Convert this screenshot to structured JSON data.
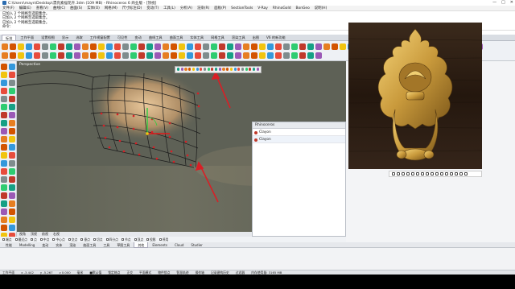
{
  "titlebar": {
    "title": "C:\\Users\\mayn\\Desktop\\漂亮素描花卉.3dm (109 MB) - Rhinoceros 6 商业版 - [顶视]",
    "controls": [
      "—",
      "□",
      "✕"
    ]
  },
  "menu": [
    "文件(F)",
    "编辑(E)",
    "查看(V)",
    "曲线(C)",
    "曲面(S)",
    "实体(O)",
    "网格(M)",
    "尺寸标注(D)",
    "变动(T)",
    "工具(L)",
    "分析(A)",
    "渲染(R)",
    "面板(P)",
    "SectionTools",
    "V-Ray",
    "RhinoGold",
    "BonGeo",
    "说明(H)"
  ],
  "command_history": [
    "已加入 2 个网格至选取集合。",
    "已加入 2 个网格至选取集合。",
    "已加入 2 个网格至选取集合。",
    "命令："
  ],
  "tabs": [
    "标准",
    "工作平面",
    "设置视图",
    "显示",
    "选取",
    "工作视窗配置",
    "可见性",
    "变动",
    "曲线工具",
    "曲面工具",
    "实体工具",
    "网格工具",
    "渲染工具",
    "出图",
    "V6 的新功能"
  ],
  "active_tab_index": 0,
  "viewport": {
    "label": "Perspective"
  },
  "viewport_tabs": [
    "视角",
    "顶视",
    "前视",
    "右视"
  ],
  "osnap": [
    "端点",
    "最近点",
    "点",
    "中点",
    "中心点",
    "交点",
    "垂点",
    "切点",
    "四分点",
    "节点",
    "顶点",
    "投影",
    "停用"
  ],
  "panel": {
    "title": "Rhinoceros",
    "items": [
      "Clayon",
      "Clayon"
    ]
  },
  "bottom_tabs": [
    "性能",
    "Modelling",
    "变动",
    "实体",
    "渲染",
    "曲面工具",
    "工具",
    "草图工具",
    "其他",
    "Elements",
    "Cloud",
    "Studier"
  ],
  "active_bottom_tab_index": 8,
  "status": [
    "工作平面",
    "x -3.442",
    "y -5.267",
    "z 0.000",
    "毫米",
    "■默认值",
    "锁定格点",
    "正交",
    "平面模式",
    "物件锁点",
    "智慧轨迹",
    "操作轴",
    "记录建构历史",
    "过滤器",
    "内存使用量: 3165 MB"
  ],
  "colors": {
    "accent_red": "#d81f26",
    "viewport_bg": "#5f6256",
    "gold": "#c99a3c"
  }
}
